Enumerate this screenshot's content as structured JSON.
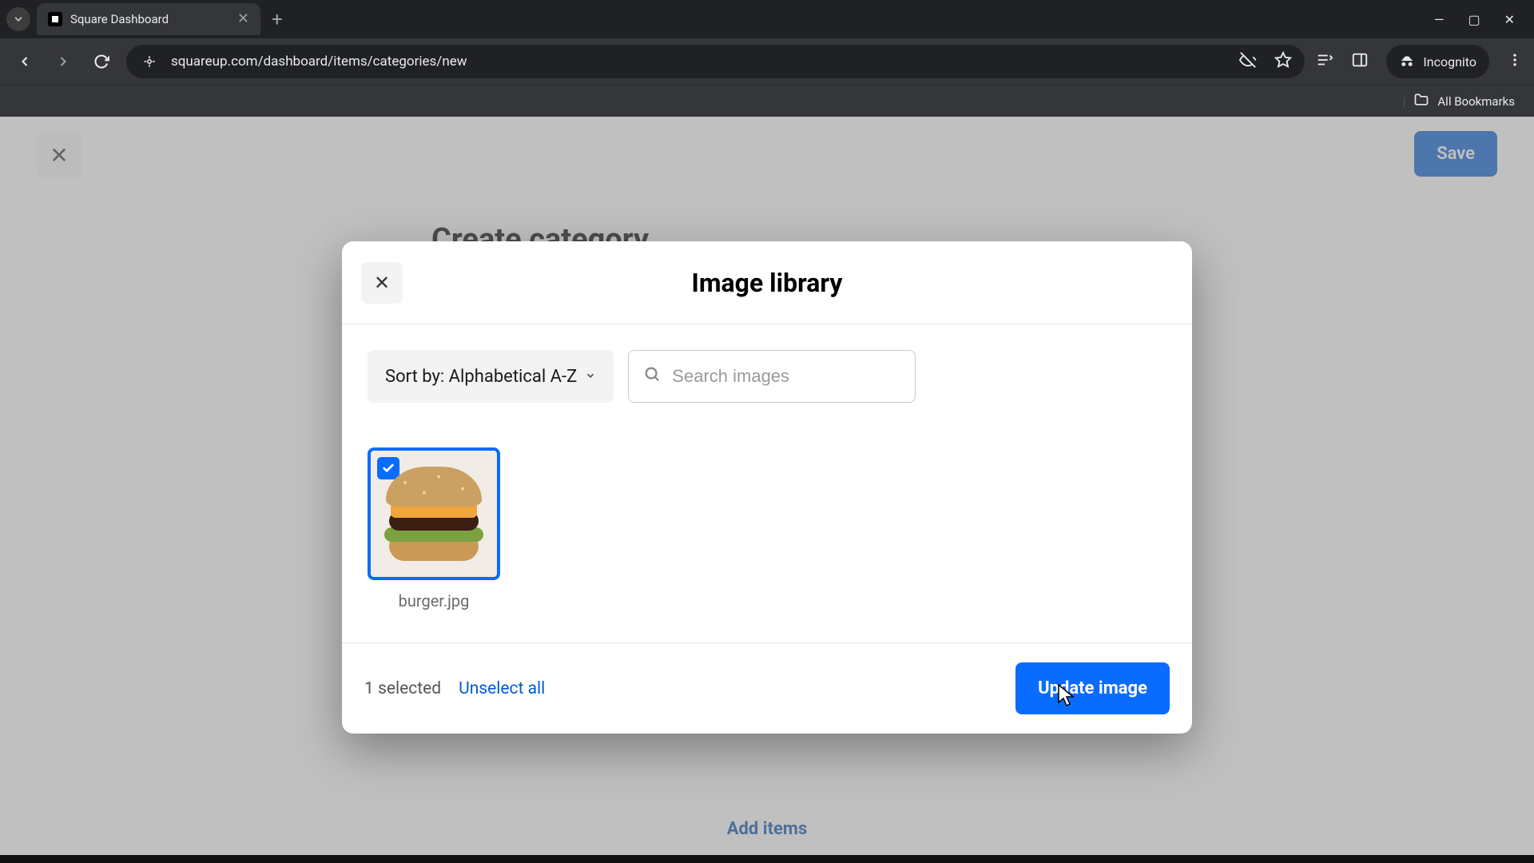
{
  "browser": {
    "tab_title": "Square Dashboard",
    "url": "squareup.com/dashboard/items/categories/new",
    "incognito_label": "Incognito",
    "all_bookmarks": "All Bookmarks"
  },
  "page": {
    "sheet_title": "Create category",
    "save_label": "Save",
    "add_items_label": "Add items"
  },
  "modal": {
    "title": "Image library",
    "sort_label": "Sort by: Alphabetical A-Z",
    "search_placeholder": "Search images",
    "images": [
      {
        "filename": "burger.jpg",
        "selected": true
      }
    ],
    "selected_count_label": "1 selected",
    "unselect_all_label": "Unselect all",
    "update_button_label": "Update image"
  }
}
